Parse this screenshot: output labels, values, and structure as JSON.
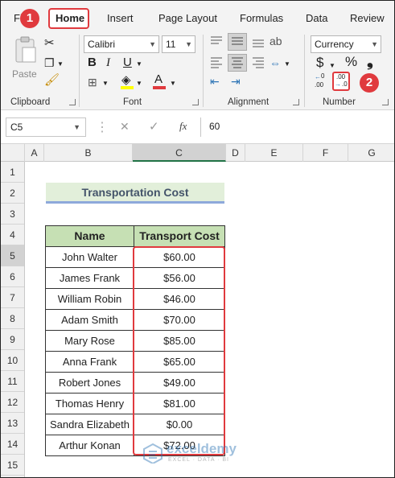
{
  "ribbon_tabs": {
    "file": "Fi",
    "home": "Home",
    "insert": "Insert",
    "page_layout": "Page Layout",
    "formulas": "Formulas",
    "data": "Data",
    "review": "Review"
  },
  "clipboard": {
    "group_label": "Clipboard",
    "paste_label": "Paste"
  },
  "font": {
    "group_label": "Font",
    "font_name": "Calibri",
    "font_size": "11"
  },
  "alignment": {
    "group_label": "Alignment"
  },
  "number": {
    "group_label": "Number",
    "format": "Currency"
  },
  "steps": {
    "step1": "1",
    "step2": "2"
  },
  "formula_bar": {
    "name_box": "C5",
    "formula_value": "60",
    "fx": "fx"
  },
  "columns": [
    "A",
    "B",
    "C",
    "D",
    "E",
    "F",
    "G"
  ],
  "rows": [
    "1",
    "2",
    "3",
    "4",
    "5",
    "6",
    "7",
    "8",
    "9",
    "10",
    "11",
    "12",
    "13",
    "14",
    "15"
  ],
  "sheet": {
    "title": "Transportation Cost",
    "header_name": "Name",
    "header_cost": "Transport Cost",
    "data": [
      {
        "name": "John Walter",
        "cost": "$60.00"
      },
      {
        "name": "James Frank",
        "cost": "$56.00"
      },
      {
        "name": "William Robin",
        "cost": "$46.00"
      },
      {
        "name": "Adam Smith",
        "cost": "$70.00"
      },
      {
        "name": "Mary Rose",
        "cost": "$85.00"
      },
      {
        "name": "Anna Frank",
        "cost": "$65.00"
      },
      {
        "name": "Robert Jones",
        "cost": "$49.00"
      },
      {
        "name": "Thomas Henry",
        "cost": "$81.00"
      },
      {
        "name": "Sandra Elizabeth",
        "cost": "$0.00"
      },
      {
        "name": "Arthur Konan",
        "cost": "$72.00"
      }
    ]
  },
  "watermark": {
    "brand": "exceldemy",
    "tagline": "EXCEL · DATA · BI"
  },
  "colors": {
    "accent_red": "#e03a3e",
    "title_fill": "#e2efda",
    "header_fill": "#c6e0b4",
    "title_text": "#44546a",
    "title_underline": "#8ea9db"
  },
  "icons": [
    "cut-icon",
    "copy-icon",
    "format-painter-icon",
    "bold-icon",
    "italic-icon",
    "underline-icon",
    "borders-icon",
    "fill-color-icon",
    "font-color-icon",
    "align-icon",
    "wrap-text-icon",
    "merge-icon",
    "dollar-icon",
    "percent-icon",
    "comma-icon",
    "increase-decimal-icon",
    "decrease-decimal-icon",
    "cancel-icon",
    "enter-icon"
  ]
}
